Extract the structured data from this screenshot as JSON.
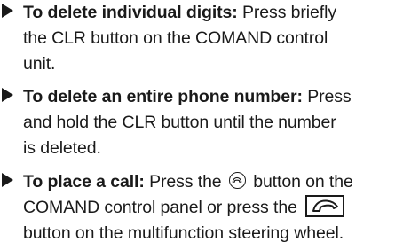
{
  "steps": [
    {
      "lead": "To delete individual digits:",
      "line1_rest": " Press briefly",
      "line2": "the CLR button on the COMAND control",
      "line3": "unit."
    },
    {
      "lead": "To delete an entire phone number:",
      "line1_rest": " Press",
      "line2": "and hold the CLR button until the number",
      "line3": "is deleted."
    },
    {
      "lead": "To place a call:",
      "line1_before_icon": " Press the ",
      "line1_after_icon": " button on the",
      "line2_before_icon": "COMAND control panel or press the ",
      "line3": "button on the multifunction steering wheel."
    }
  ],
  "icons": {
    "round_call_button": "phone-handset-icon",
    "steering_wheel_call_button": "phone-handset-icon"
  }
}
